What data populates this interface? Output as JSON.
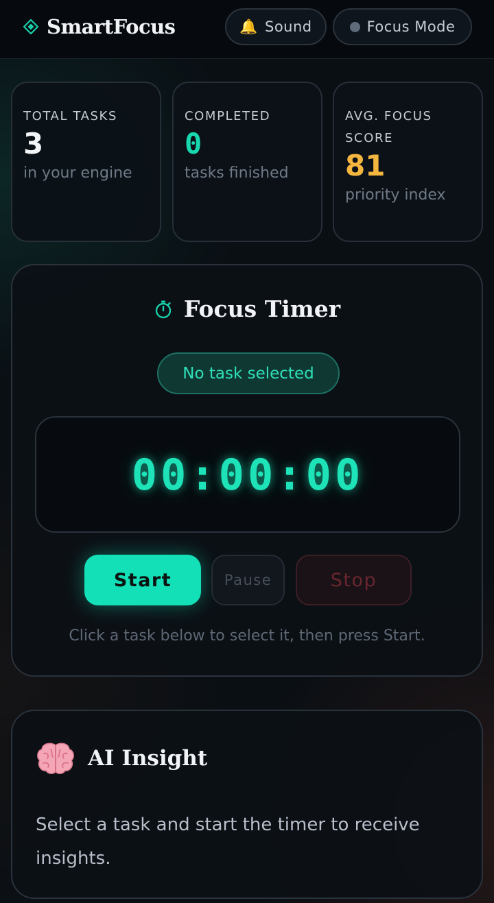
{
  "header": {
    "brand": "SmartFocus",
    "sound_label": "Sound",
    "focus_mode_label": "Focus Mode"
  },
  "stats": [
    {
      "label": "TOTAL TASKS",
      "value": "3",
      "sub": "in your engine"
    },
    {
      "label": "COMPLETED",
      "value": "0",
      "sub": "tasks finished"
    },
    {
      "label": "AVG. FOCUS SCORE",
      "value": "81",
      "sub": "priority index"
    }
  ],
  "timer": {
    "title": "Focus Timer",
    "task_status": "No task selected",
    "display": "00:00:00",
    "start_label": "Start",
    "pause_label": "Pause",
    "stop_label": "Stop",
    "hint": "Click a task below to select it, then press Start."
  },
  "insight": {
    "title": "AI Insight",
    "body": "Select a task and start the timer to receive insights."
  },
  "icons": {
    "brand": "diamond-icon",
    "sound": "bell-icon",
    "focus_mode": "status-dot-icon",
    "timer": "stopwatch-icon",
    "insight": "brain-icon"
  },
  "colors": {
    "accent": "#14e0b8",
    "amber": "#f5b640",
    "background": "#0a0f14",
    "stop": "#6a2630"
  }
}
